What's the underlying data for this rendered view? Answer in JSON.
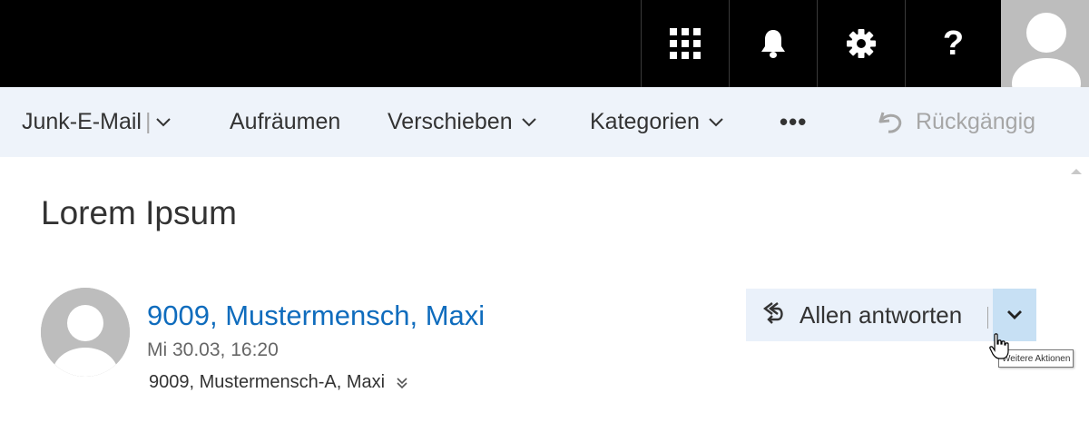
{
  "topbar": {
    "icons": [
      "app-launcher-icon",
      "bell-icon",
      "gear-icon",
      "help-icon",
      "avatar"
    ],
    "help_label": "?"
  },
  "commandbar": {
    "junk": "Junk-E-Mail",
    "junk_sep": "|",
    "sweep": "Aufräumen",
    "move": "Verschieben",
    "categories": "Kategorien",
    "more": "•••",
    "undo": "Rückgängig"
  },
  "message": {
    "subject": "Lorem Ipsum",
    "sender": "9009, Mustermensch, Maxi",
    "date": "Mi 30.03, 16:20",
    "recipients": "9009, Mustermensch-A, Maxi"
  },
  "actions": {
    "reply_all": "Allen antworten",
    "more_actions_tooltip": "Weitere Aktionen"
  },
  "colors": {
    "topbar": "#000000",
    "commandbar": "#eef3fa",
    "link": "#0f6cbd",
    "button_bg": "#eaf1fa",
    "dropdown_hover": "#c7e0f4"
  }
}
